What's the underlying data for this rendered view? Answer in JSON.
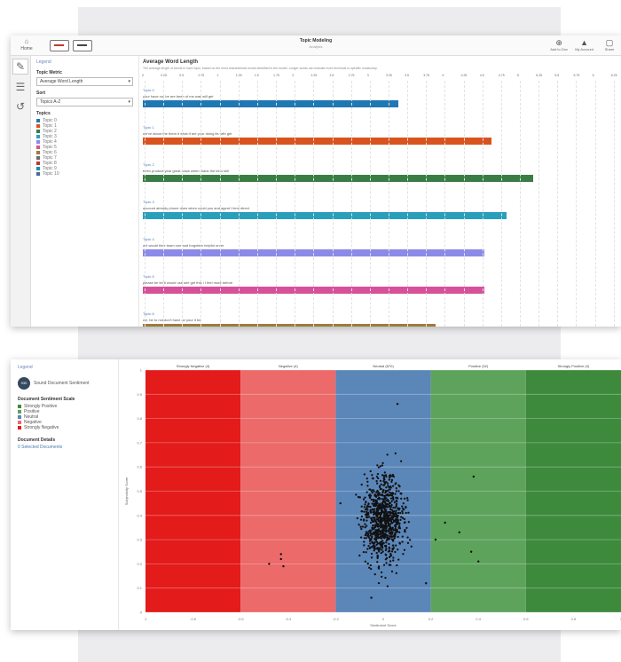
{
  "colors": {
    "panel_bg": "#ececee",
    "accent": "#4b78b5",
    "strongly_negative": "#e31b1b",
    "negative": "#ec6a6a",
    "neutral": "#5b86b8",
    "positive": "#5da35c",
    "strongly_positive": "#3d8a3c"
  },
  "toolbar": {
    "home_label": "Home",
    "title": "Topic Modeling",
    "subtitle": "Analysis",
    "tools": [
      {
        "label": "Add to Doc",
        "icon": "add-doc-icon"
      },
      {
        "label": "My Account",
        "icon": "user-icon"
      },
      {
        "label": "Share",
        "icon": "share-icon"
      }
    ]
  },
  "sidebar": {
    "header": "Legend",
    "metric_label": "Topic Metric",
    "metric_value": "Average Word Length",
    "sort_label": "Sort",
    "sort_value": "Topics A-Z",
    "topics_label": "Topics",
    "topics": [
      {
        "name": "Topic 0",
        "color": "#1f77b4"
      },
      {
        "name": "Topic 1",
        "color": "#d9531e"
      },
      {
        "name": "Topic 2",
        "color": "#3a7d44"
      },
      {
        "name": "Topic 3",
        "color": "#2a9fbc"
      },
      {
        "name": "Topic 4",
        "color": "#8b8ae8"
      },
      {
        "name": "Topic 5",
        "color": "#d6519a"
      },
      {
        "name": "Topic 6",
        "color": "#9e7b3a"
      },
      {
        "name": "Topic 7",
        "color": "#6b6b6b"
      },
      {
        "name": "Topic 8",
        "color": "#c0392b"
      },
      {
        "name": "Topic 9",
        "color": "#1a8fb0"
      },
      {
        "name": "Topic 10",
        "color": "#4a6a9a"
      }
    ]
  },
  "chart_data": [
    {
      "type": "bar",
      "title": "Average Word Length",
      "description": "The average length of words in each topic, based on the most characteristic words identified in the model. Longer words can indicate more technical or specific vocabulary.",
      "xlim": [
        0,
        6.3
      ],
      "ticks": [
        "0",
        "0.25",
        "0.5",
        "0.75",
        "1",
        "1.25",
        "1.5",
        "1.75",
        "2",
        "2.25",
        "2.5",
        "2.75",
        "3",
        "3.25",
        "3.5",
        "3.75",
        "4",
        "4.25",
        "4.5",
        "4.75",
        "5",
        "5.25",
        "5.5",
        "5.75",
        "6",
        "6.25"
      ],
      "categories": [
        "Topic 0",
        "Topic 1",
        "Topic 2",
        "Topic 3",
        "Topic 4",
        "Topic 5",
        "Topic 6"
      ],
      "top_words": [
        "your have not be are been of me was will get",
        "we've about the them it what if are your doing its with get",
        "been product year great show when thank the best still",
        "account already phone does when could you and agent I item direct",
        "a it would time team one and forgotten helpful order",
        "please be let it would use see get this I I feel more before",
        "we, be to not don't have an your it be"
      ],
      "values": [
        3.4,
        4.65,
        5.2,
        4.85,
        4.55,
        4.55,
        3.9
      ],
      "colors": [
        "#1f77b4",
        "#d9531e",
        "#3a7d44",
        "#2a9fbc",
        "#8b8ae8",
        "#d6519a",
        "#9e7b3a"
      ]
    },
    {
      "type": "scatter",
      "x_range": [
        -1,
        1
      ],
      "y_range": [
        0,
        1
      ],
      "bands": [
        {
          "label": "Strongly Negative (4)",
          "color": "#e31b1b"
        },
        {
          "label": "Negative (4)",
          "color": "#ec6a6a"
        },
        {
          "label": "Neutral (870)",
          "color": "#5b86b8"
        },
        {
          "label": "Positive (52)",
          "color": "#5da35c"
        },
        {
          "label": "Strongly Positive (0)",
          "color": "#3d8a3c"
        }
      ],
      "x_ticks": [
        "-1",
        "-0.8",
        "-0.6",
        "-0.4",
        "-0.2",
        "0",
        "0.2",
        "0.4",
        "0.6",
        "0.8",
        "1"
      ],
      "y_ticks": [
        "0",
        "0.1",
        "0.2",
        "0.3",
        "0.4",
        "0.5",
        "0.6",
        "0.7",
        "0.8",
        "0.9",
        "1"
      ],
      "xlabel": "Sentiment Score",
      "ylabel": "Subjectivity Score",
      "neutral_cluster": {
        "count": 870,
        "x_center": 0.0,
        "x_spread": 0.06,
        "y_center": 0.38,
        "y_spread": 0.12
      },
      "outliers": [
        {
          "x": -0.48,
          "y": 0.2
        },
        {
          "x": -0.43,
          "y": 0.22
        },
        {
          "x": -0.42,
          "y": 0.19
        },
        {
          "x": -0.43,
          "y": 0.24
        },
        {
          "x": 0.38,
          "y": 0.56
        },
        {
          "x": 0.32,
          "y": 0.33
        },
        {
          "x": 0.37,
          "y": 0.25
        },
        {
          "x": 0.4,
          "y": 0.21
        },
        {
          "x": 0.22,
          "y": 0.3
        },
        {
          "x": 0.18,
          "y": 0.12
        },
        {
          "x": 0.06,
          "y": 0.86
        },
        {
          "x": -0.05,
          "y": 0.06
        },
        {
          "x": -0.18,
          "y": 0.45
        },
        {
          "x": 0.26,
          "y": 0.37
        }
      ]
    }
  ],
  "legend2": {
    "header": "Legend",
    "doc_count": "930",
    "doc_count_label": "Sound Document Sentiment",
    "classes_label": "Document Sentiment Scale",
    "classes": [
      {
        "name": "Strongly Positive",
        "color": "#3d8a3c"
      },
      {
        "name": "Positive",
        "color": "#5da35c"
      },
      {
        "name": "Neutral",
        "color": "#5b86b8"
      },
      {
        "name": "Negative",
        "color": "#ec6a6a"
      },
      {
        "name": "Strongly Negative",
        "color": "#e31b1b"
      }
    ],
    "details_label": "Document Details",
    "details_link": "0 Selected Documents"
  }
}
